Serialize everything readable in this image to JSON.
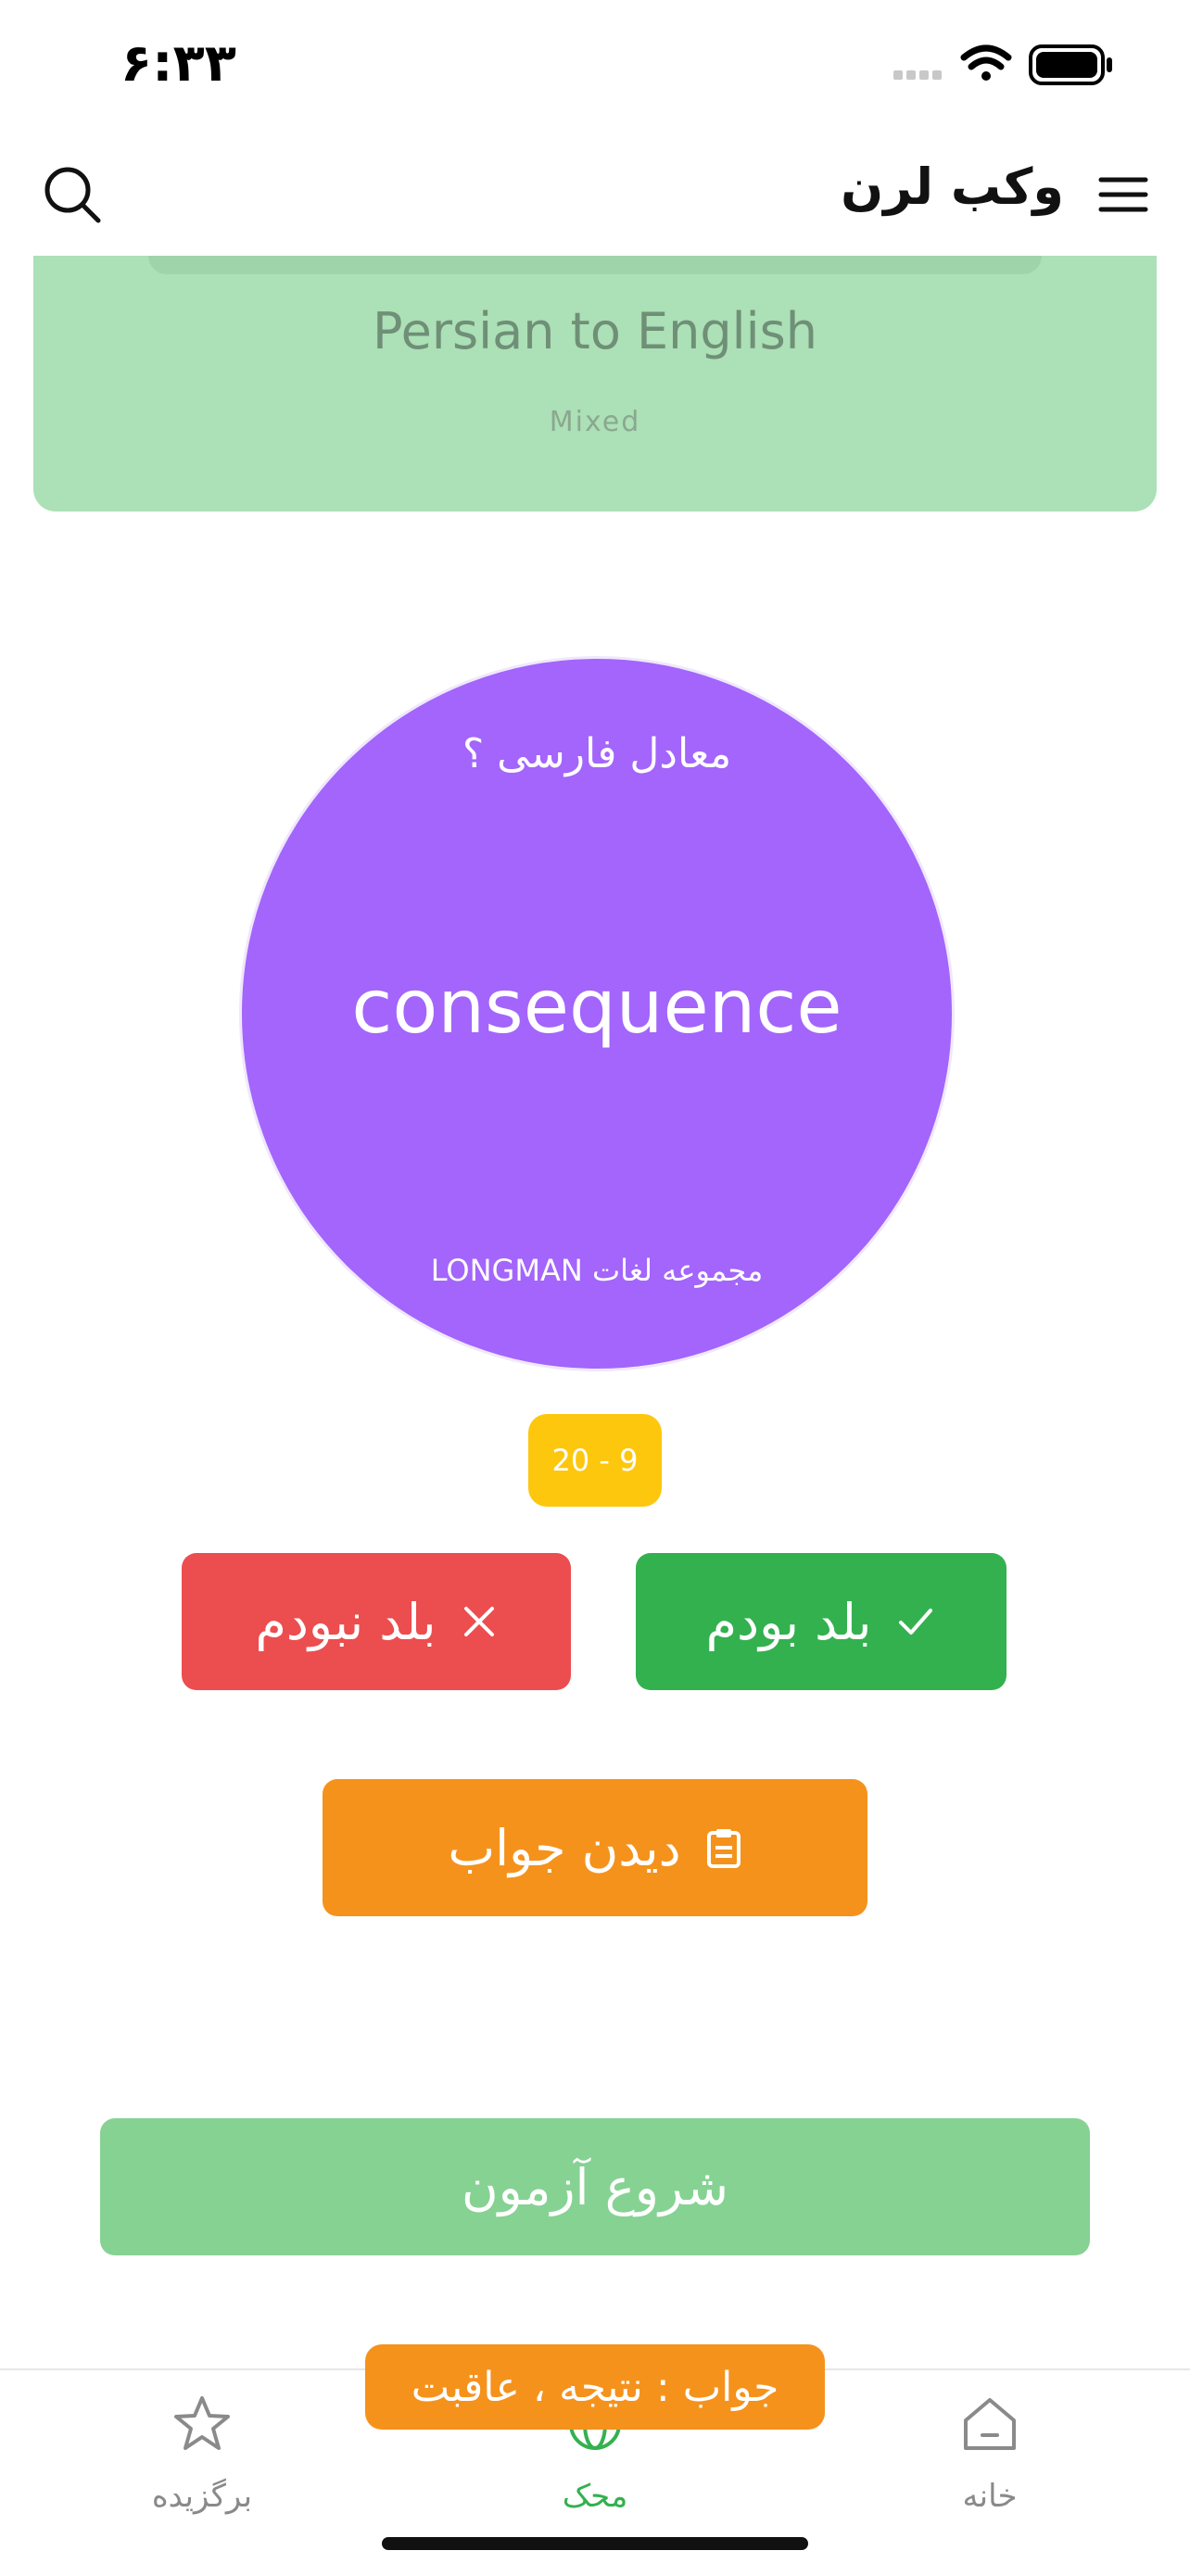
{
  "status_bar": {
    "time": "۶:۳۳"
  },
  "header": {
    "title": "وکب لرن"
  },
  "category_card": {
    "title": "Persian to English",
    "subtitle": "Mixed"
  },
  "flash_card": {
    "question": "معادل فارسی ؟",
    "word": "consequence",
    "source": "مجموعه لغات LONGMAN"
  },
  "progress": {
    "counter": "20 - 9"
  },
  "buttons": {
    "knew": "بلد بودم",
    "didnt_know": "بلد نبودم",
    "show_answer": "دیدن جواب",
    "start_test": "شروع آزمون"
  },
  "answer": {
    "text": "جواب : نتیجه ، عاقبت"
  },
  "tabbar": {
    "home": "خانه",
    "study": "محک",
    "favorites": "برگزیده"
  },
  "colors": {
    "accent_purple": "#a365fb",
    "success_green": "#33b14f",
    "danger_red": "#ec4d4f",
    "warning_orange": "#f5921c",
    "counter_yellow": "#fdc70e",
    "start_green": "#86d293",
    "card_green": "#ace0b6"
  },
  "icons": {
    "menu": "menu-icon",
    "search": "search-icon",
    "check": "check-icon",
    "close": "close-icon",
    "clipboard": "clipboard-icon",
    "home": "home-icon",
    "globe": "globe-icon",
    "star": "star-icon",
    "wifi": "wifi-icon",
    "battery": "battery-icon",
    "signal": "signal-icon"
  }
}
